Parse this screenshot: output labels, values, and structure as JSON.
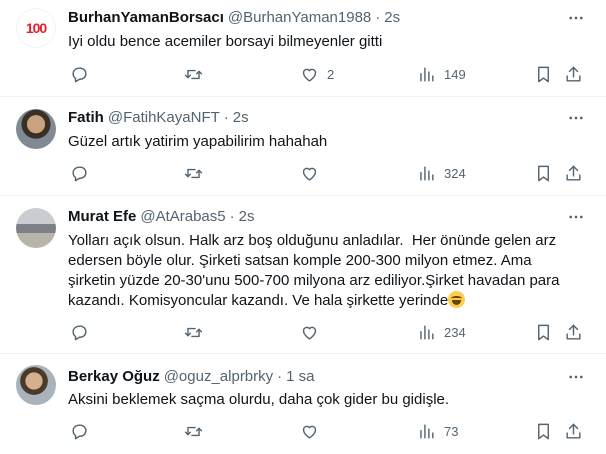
{
  "tweets": [
    {
      "name": "BurhanYamanBorsacı",
      "handle": "@BurhanYaman1988",
      "dot": "·",
      "time": "2s",
      "text": "Iyi oldu bence acemiler borsayi bilmeyenler gitti",
      "replies": "",
      "retweets": "",
      "likes": "2",
      "views": "149",
      "avatar_text": "100"
    },
    {
      "name": "Fatih",
      "handle": "@FatihKayaNFT",
      "dot": "·",
      "time": "2s",
      "text": "Güzel artık yatirim yapabilirim hahahah",
      "replies": "",
      "retweets": "",
      "likes": "",
      "views": "324"
    },
    {
      "name": "Murat Efe",
      "handle": "@AtArabas5",
      "dot": "·",
      "time": "2s",
      "text": "Yolları açık olsun. Halk arz boş olduğunu anladılar.  Her önünde gelen arz edersen böyle olur. Şirketi satsan komple 200-300 milyon etmez. Ama şirketin yüzde 20-30'unu 500-700 milyona arz ediliyor.Şirket havadan para kazandı. Komisyoncular kazandı. Ve hala şirkette yerinde",
      "replies": "",
      "retweets": "",
      "likes": "",
      "views": "234"
    },
    {
      "name": "Berkay Oğuz",
      "handle": "@oguz_alprbrky",
      "dot": "·",
      "time": "1 sa",
      "text": "Aksini beklemek saçma olurdu, daha çok gider bu gidişle.",
      "replies": "",
      "retweets": "",
      "likes": "",
      "views": "73"
    }
  ],
  "icons": {
    "reply": "reply-icon",
    "retweet": "retweet-icon",
    "like": "heart-icon",
    "views": "views-icon",
    "bookmark": "bookmark-icon",
    "share": "share-icon",
    "more": "more-icon",
    "emoji": "laughing-emoji-icon"
  },
  "colors": {
    "text_primary": "#0f1419",
    "text_secondary": "#536471",
    "divider": "#eff3f4",
    "brand_red": "#e0202a"
  }
}
